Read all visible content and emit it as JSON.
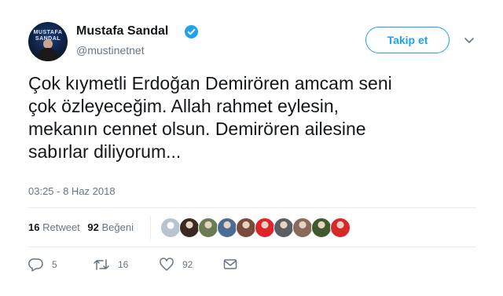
{
  "author": {
    "name": "Mustafa Sandal",
    "handle": "@mustinetnet",
    "avatar_text": "MUSTAFA SANDAL",
    "verified": true
  },
  "follow_button_label": "Takip et",
  "more_options_icon": "chevron-down-icon",
  "tweet_lines": [
    "Çok kıymetli Erdoğan Demirören amcam seni",
    "çok özleyeceğim. Allah rahmet eylesin,",
    "mekanın cennet olsun. Demirören ailesine",
    "sabırlar diliyorum..."
  ],
  "timestamp": "03:25 - 8 Haz 2018",
  "stats": {
    "retweet_count": "16",
    "retweet_label": "Retweet",
    "like_count": "92",
    "like_label": "Beğeni"
  },
  "likers": [
    {
      "color": "#b7c3cf",
      "icon": "default-avatar"
    },
    {
      "color": "#3a2a22",
      "icon": "avatar"
    },
    {
      "color": "#6b7c54",
      "icon": "avatar"
    },
    {
      "color": "#4b6d95",
      "icon": "avatar"
    },
    {
      "color": "#7a4a3a",
      "icon": "avatar"
    },
    {
      "color": "#e0242b",
      "icon": "avatar"
    },
    {
      "color": "#5a5f66",
      "icon": "avatar"
    },
    {
      "color": "#8a6a5a",
      "icon": "avatar"
    },
    {
      "color": "#3f5a2e",
      "icon": "avatar"
    },
    {
      "color": "#d62a2a",
      "icon": "avatar"
    }
  ],
  "actions": {
    "reply_count": "5",
    "retweet_count": "16",
    "like_count": "92"
  },
  "colors": {
    "accent": "#1da1f2",
    "muted": "#657786",
    "text": "#14171a"
  }
}
